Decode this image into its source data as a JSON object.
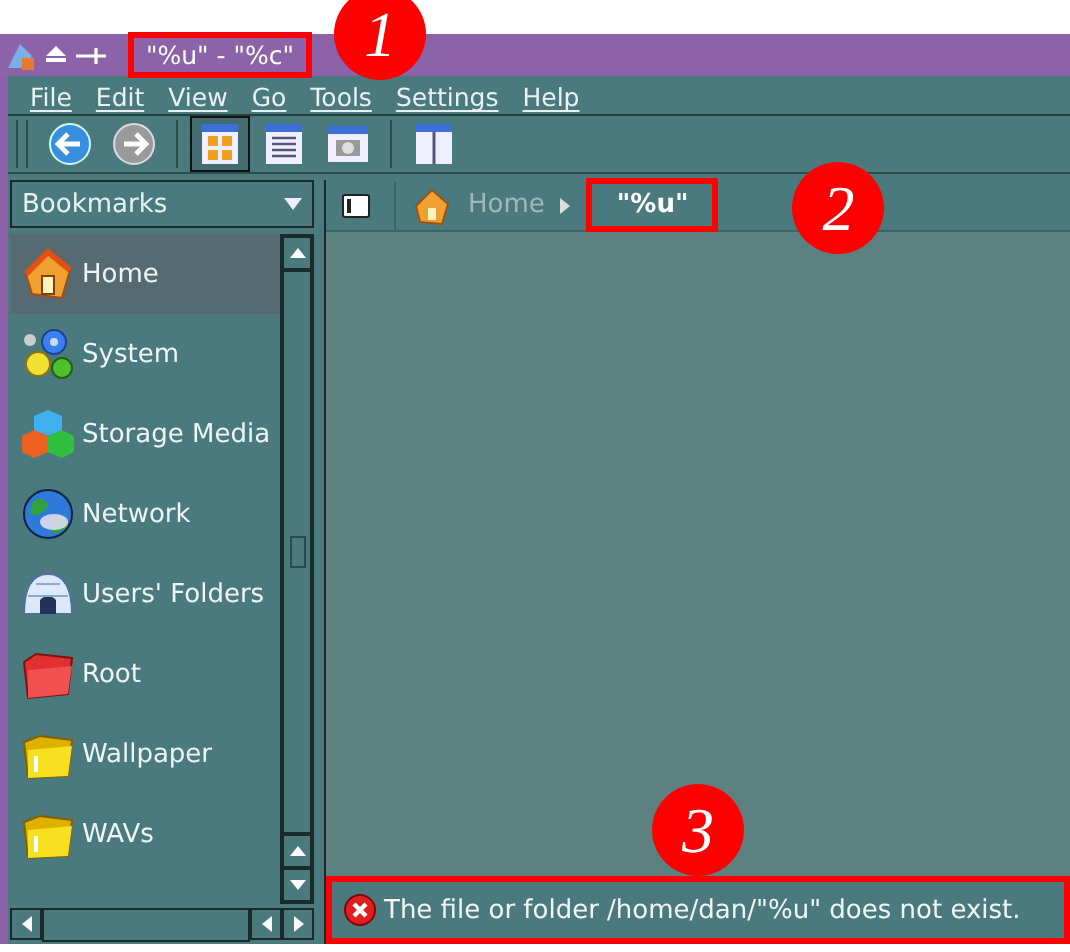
{
  "window": {
    "title": "\"%u\" - \"%c\"",
    "callout": "1"
  },
  "menu": [
    "File",
    "Edit",
    "View",
    "Go",
    "Tools",
    "Settings",
    "Help"
  ],
  "toolbar": [
    {
      "kind": "back"
    },
    {
      "kind": "forward"
    },
    {
      "kind": "separator"
    },
    {
      "kind": "icon-view",
      "selected": true
    },
    {
      "kind": "list-view",
      "selected": false
    },
    {
      "kind": "image-view",
      "selected": false
    },
    {
      "kind": "separator"
    },
    {
      "kind": "split"
    }
  ],
  "sidebar": {
    "dropdown": "Bookmarks",
    "items": [
      {
        "label": "Home",
        "kind": "home",
        "selected": true
      },
      {
        "label": "System",
        "kind": "gears",
        "selected": false
      },
      {
        "label": "Storage Media",
        "kind": "cubes",
        "selected": false
      },
      {
        "label": "Network",
        "kind": "globe",
        "selected": false
      },
      {
        "label": "Users' Folders",
        "kind": "igloo",
        "selected": false
      },
      {
        "label": "Root",
        "kind": "red-folder",
        "selected": false
      },
      {
        "label": "Wallpaper",
        "kind": "yellow-folder",
        "selected": false
      },
      {
        "label": "WAVs",
        "kind": "yellow-folder",
        "selected": false
      }
    ]
  },
  "location": {
    "crumbs": [
      {
        "label": "Home",
        "current": false
      },
      {
        "label": "\"%u\"",
        "current": true,
        "callout": "2"
      }
    ]
  },
  "status_bar": {
    "message": "The file or folder /home/dan/\"%u\" does not exist.",
    "error": true,
    "callout": "3"
  }
}
